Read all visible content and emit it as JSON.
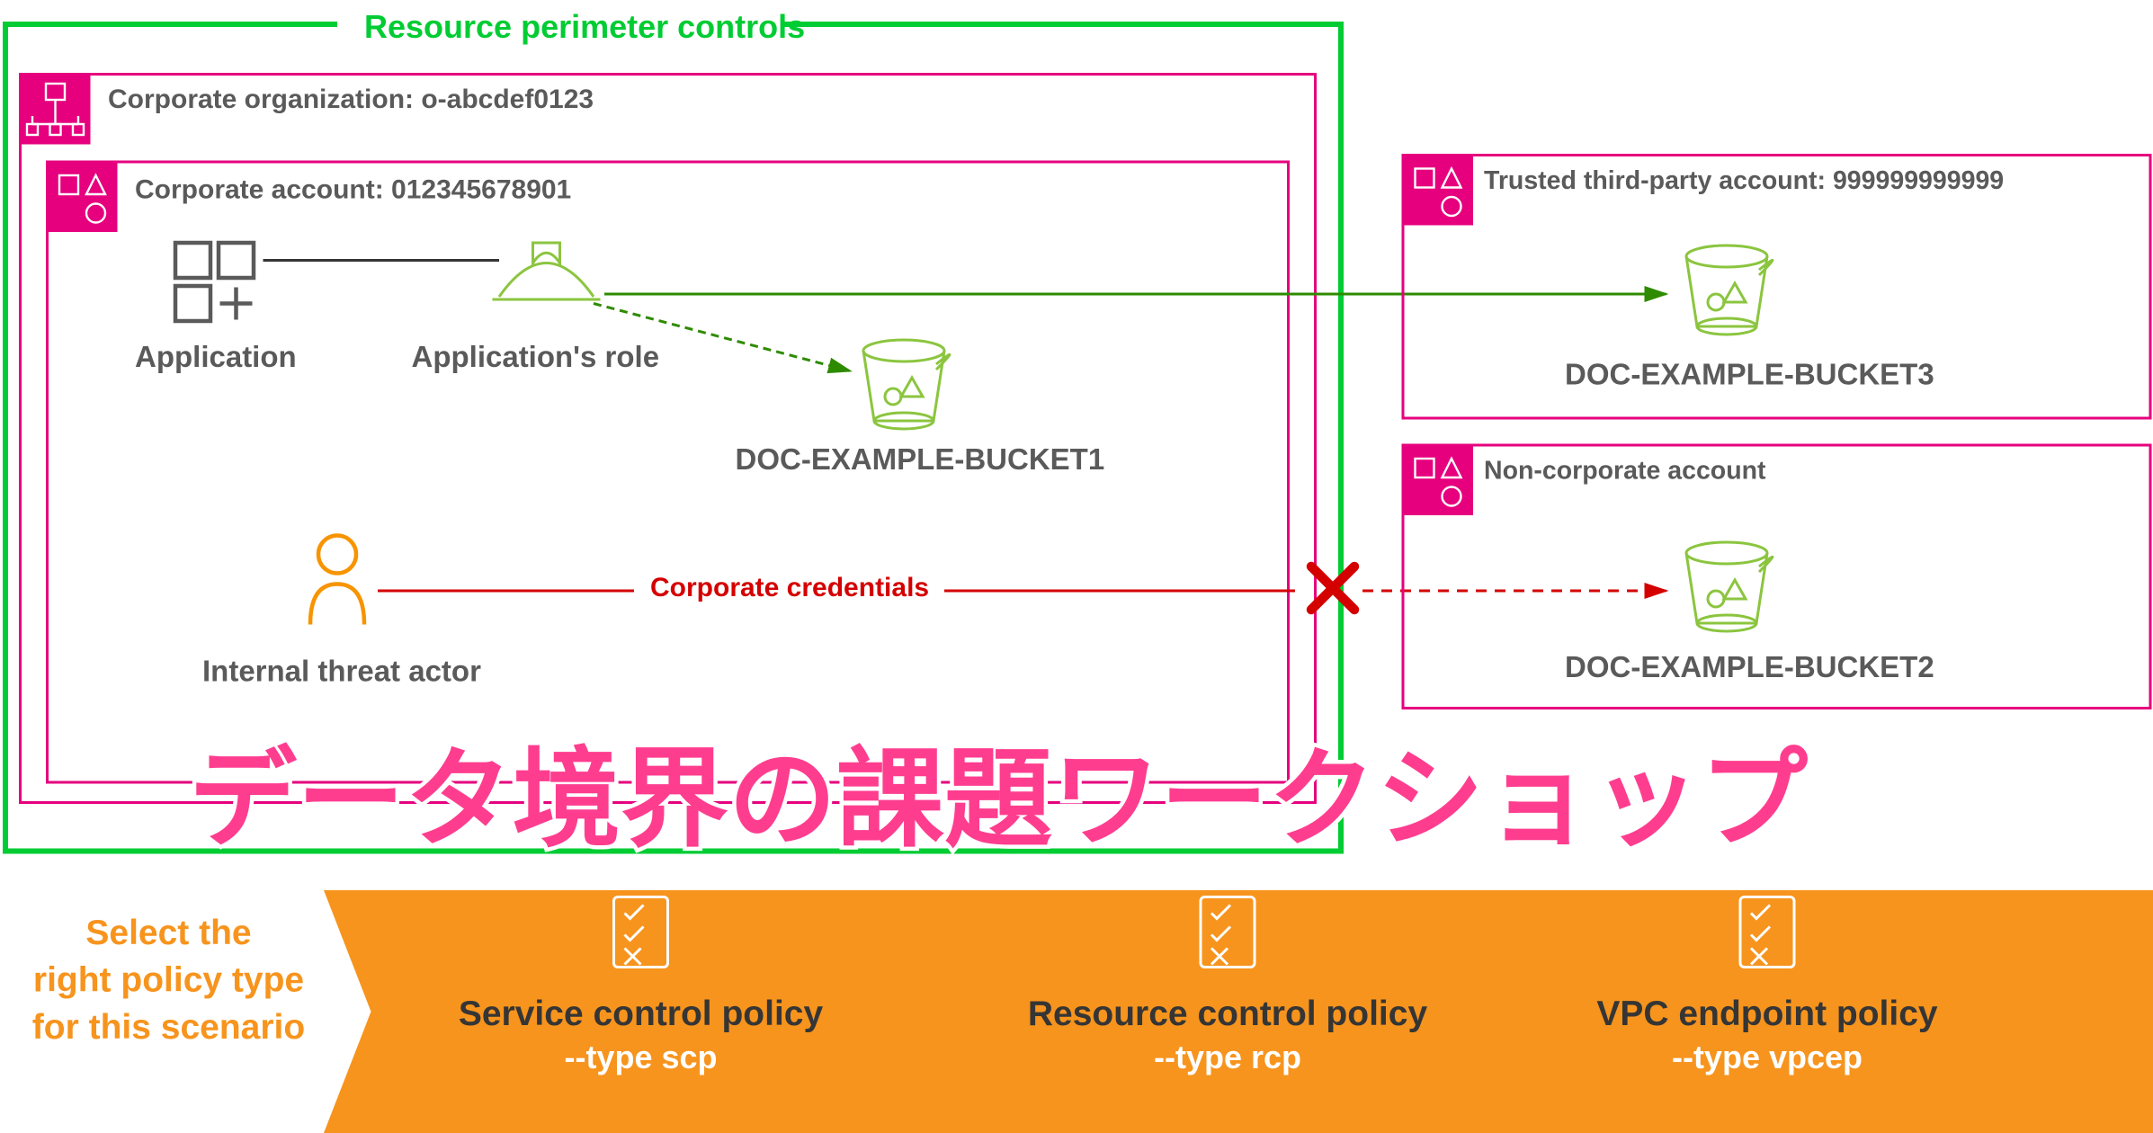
{
  "perimeter_label": "Resource perimeter controls",
  "org_label": "Corporate organization: o-abcdef0123",
  "account_label": "Corporate account: 012345678901",
  "application_label": "Application",
  "role_label": "Application's role",
  "bucket1_label": "DOC-EXAMPLE-BUCKET1",
  "actor_label": "Internal threat actor",
  "credentials_label": "Corporate credentials",
  "third_party_label": "Trusted third-party account: 999999999999",
  "bucket3_label": "DOC-EXAMPLE-BUCKET3",
  "noncorp_label": "Non-corporate account",
  "bucket2_label": "DOC-EXAMPLE-BUCKET2",
  "jp_title": "データ境界の課題ワークショップ",
  "footer_prompt_l1": "Select the",
  "footer_prompt_l2": "right policy type",
  "footer_prompt_l3": "for this scenario",
  "policy1_name": "Service control policy",
  "policy1_flag": "--type scp",
  "policy2_name": "Resource control policy",
  "policy2_flag": "--type rcp",
  "policy3_name": "VPC endpoint policy",
  "policy3_flag": "--type vpcep"
}
